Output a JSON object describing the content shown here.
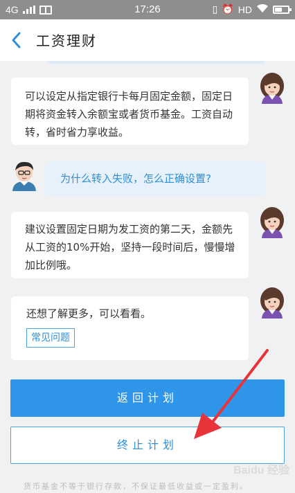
{
  "status_bar": {
    "network": "4G",
    "time": "17:26",
    "hd": "HD"
  },
  "header": {
    "title": "工资理财"
  },
  "messages": [
    {
      "role": "agent",
      "text": "可以设定从指定银行卡每月固定金额，固定日期将资金转入余额宝或者货币基金。工资自动转，省时省力享收益。"
    },
    {
      "role": "user",
      "text": "为什么转入失败，怎么正确设置?"
    },
    {
      "role": "agent",
      "text": "建议设置固定日期为发工资的第二天，金额先从工资的10%开始，坚持一段时间后，慢慢增加比例哦。"
    },
    {
      "role": "agent",
      "text": "还想了解更多，可以看看。",
      "link": "常见问题"
    }
  ],
  "buttons": {
    "return_label": "返回计划",
    "stop_label": "终止计划"
  },
  "disclaimer": "货币基金不等于银行存款，不保证最低收益或一定盈利。",
  "watermark": "Baidu 经验",
  "colors": {
    "accent": "#2e95e8",
    "status_bar": "#8e8e8e",
    "annotation_arrow": "#e8333a"
  }
}
